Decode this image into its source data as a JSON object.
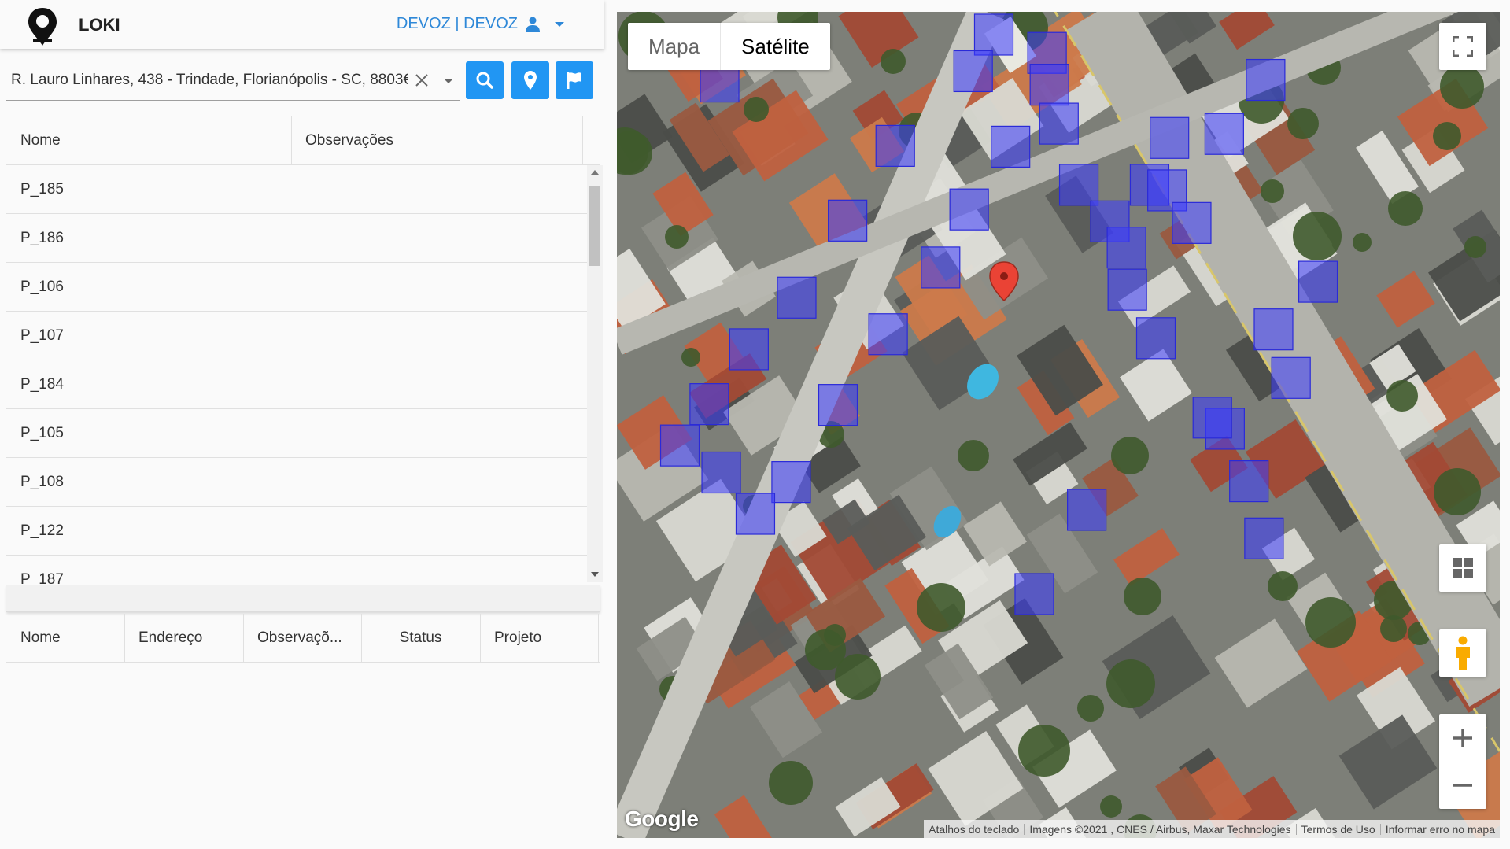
{
  "header": {
    "app_name": "LOKI",
    "user_label": "DEVOZ | DEVOZ",
    "icons": {
      "logo": "map-pin-logo",
      "user": "user-icon",
      "menu": "caret-down-icon"
    }
  },
  "search": {
    "value": "R. Lauro Linhares, 438 - Trindade, Florianópolis - SC, 8803€",
    "icons": [
      "close-icon",
      "caret-down-icon",
      "search-icon",
      "map-marker-icon",
      "flag-icon"
    ]
  },
  "points_grid": {
    "columns": [
      "Nome",
      "Observações"
    ],
    "rows": [
      {
        "nome": "P_185",
        "obs": ""
      },
      {
        "nome": "P_186",
        "obs": ""
      },
      {
        "nome": "P_106",
        "obs": ""
      },
      {
        "nome": "P_107",
        "obs": ""
      },
      {
        "nome": "P_184",
        "obs": ""
      },
      {
        "nome": "P_105",
        "obs": ""
      },
      {
        "nome": "P_108",
        "obs": ""
      },
      {
        "nome": "P_122",
        "obs": ""
      },
      {
        "nome": "P_187",
        "obs": ""
      }
    ]
  },
  "details_grid": {
    "columns": [
      "Nome",
      "Endereço",
      "Observaçõ...",
      "Status",
      "Projeto"
    ]
  },
  "map": {
    "type_buttons": [
      "Mapa",
      "Satélite"
    ],
    "selected_type": "Satélite",
    "google_logo": "Google",
    "attribution": [
      "Atalhos do teclado",
      "Imagens ©2021 , CNES / Airbus, Maxar Technologies",
      "Termos de Uso",
      "Informar erro no mapa"
    ],
    "overlay_color": "#3b3bff",
    "marker_color": "#ea4335",
    "accent": "#2196f3"
  }
}
